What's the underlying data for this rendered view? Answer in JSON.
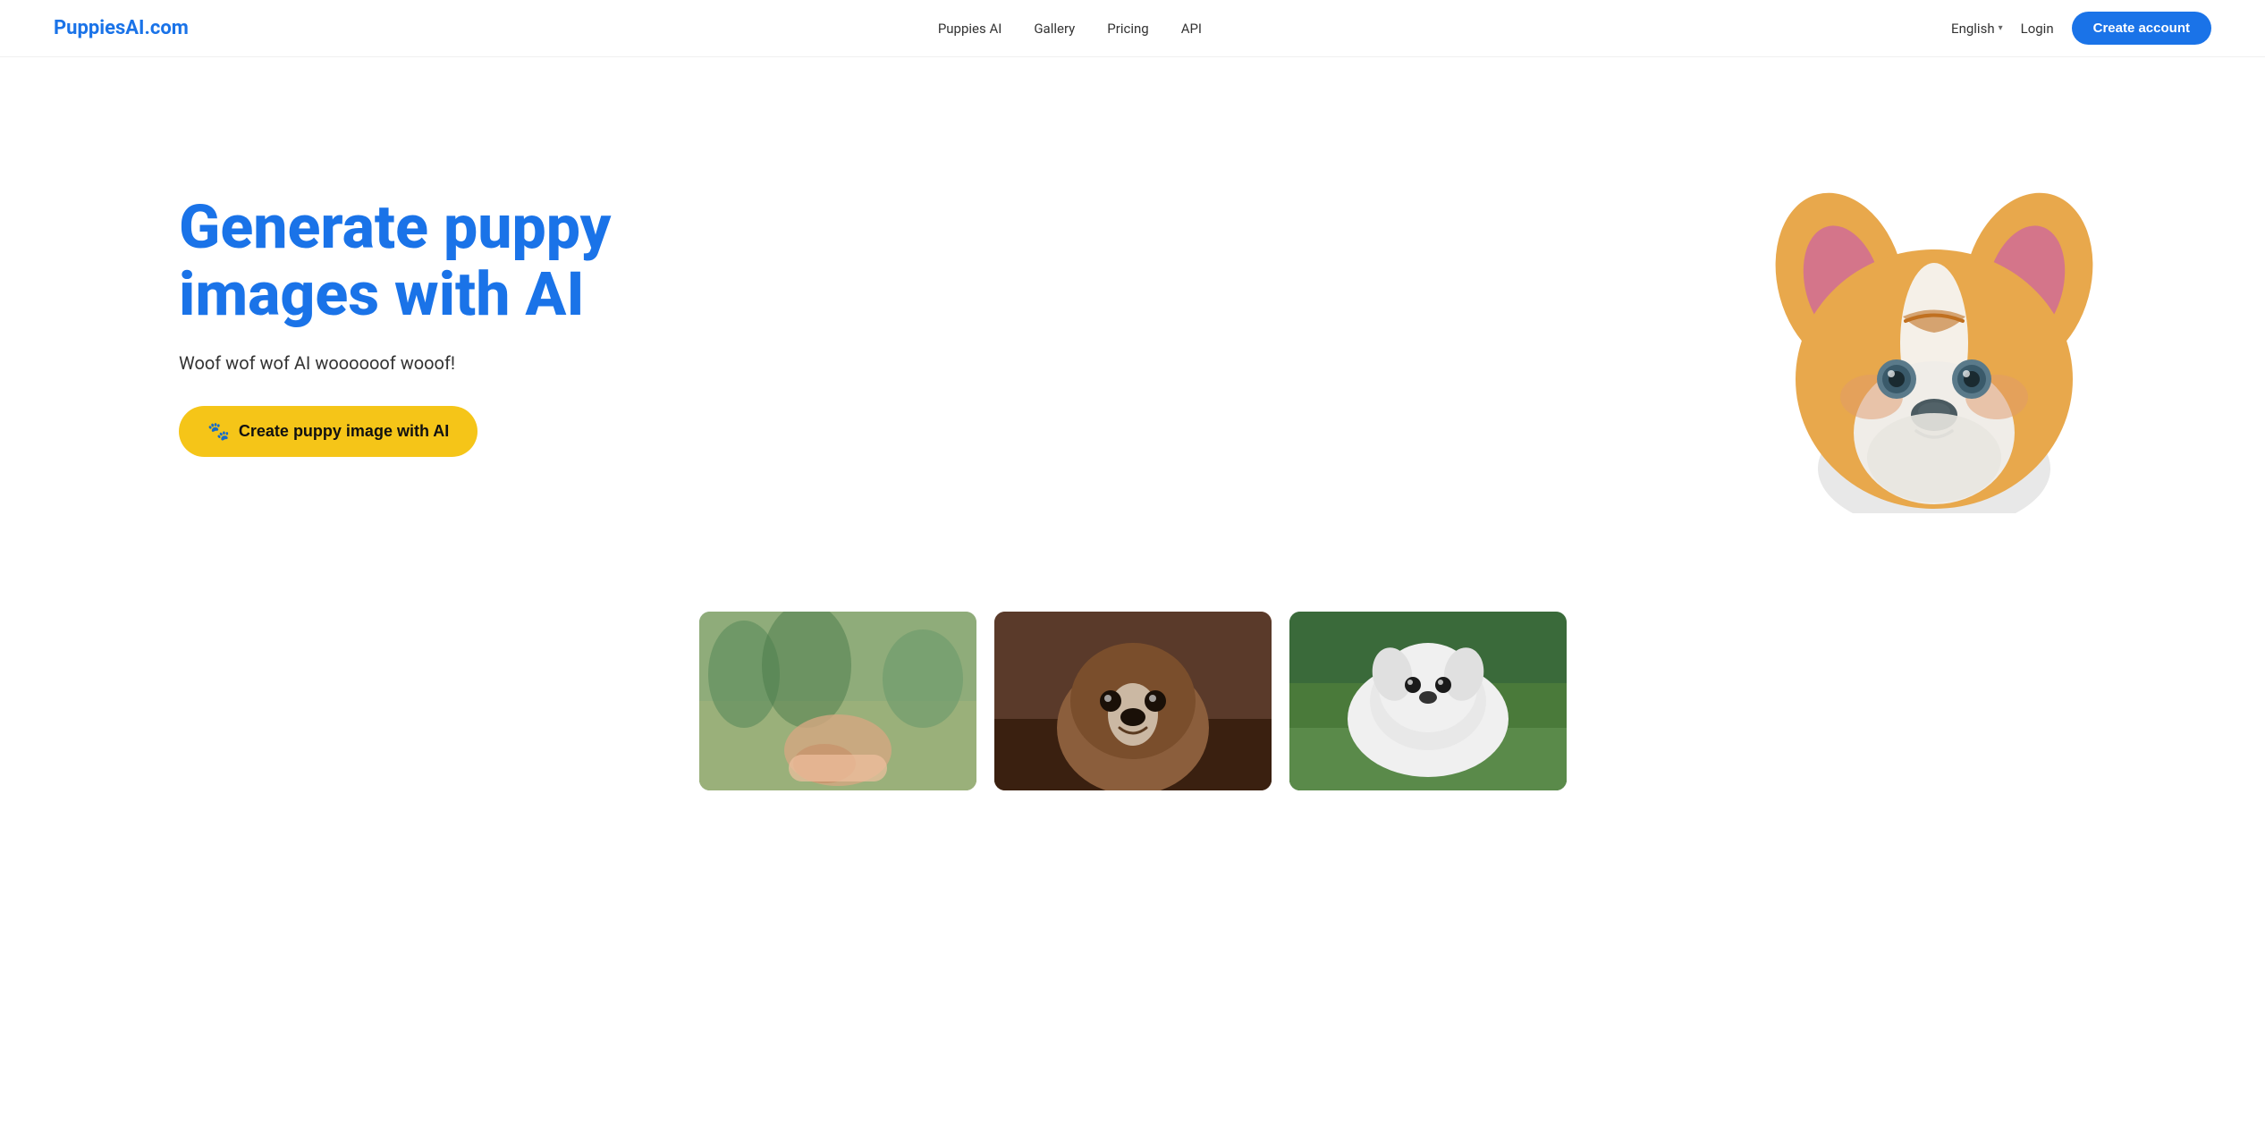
{
  "nav": {
    "logo": "PuppiesAI.com",
    "links": [
      {
        "id": "puppies-ai",
        "label": "Puppies AI"
      },
      {
        "id": "gallery",
        "label": "Gallery"
      },
      {
        "id": "pricing",
        "label": "Pricing"
      },
      {
        "id": "api",
        "label": "API"
      }
    ],
    "language": {
      "label": "English",
      "chevron": "▾"
    },
    "login_label": "Login",
    "create_account_label": "Create account"
  },
  "hero": {
    "title": "Generate puppy images with AI",
    "subtitle": "Woof wof wof AI woooooof wooof!",
    "cta_label": "Create puppy image with AI",
    "paw_icon": "🐾"
  },
  "gallery": {
    "images": [
      {
        "id": "gallery-img-1",
        "alt": "Puppy in park"
      },
      {
        "id": "gallery-img-2",
        "alt": "Brown and white puppy"
      },
      {
        "id": "gallery-img-3",
        "alt": "White puppy on grass"
      }
    ]
  }
}
